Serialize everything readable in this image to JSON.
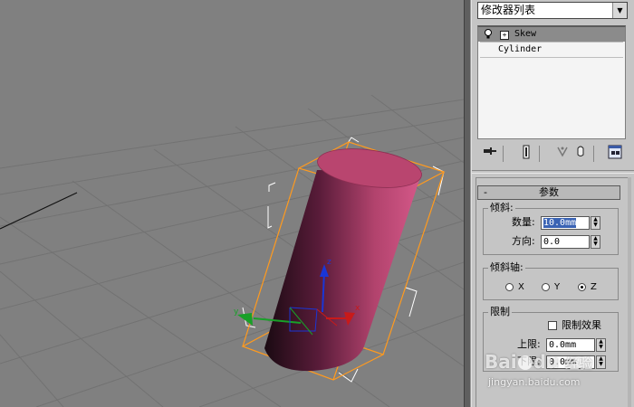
{
  "modifier_list": {
    "label": "修改器列表",
    "arrow": "▼"
  },
  "stack": {
    "items": [
      {
        "label": "Skew",
        "selected": true
      },
      {
        "label": "Cylinder",
        "selected": false
      }
    ]
  },
  "toolbar": {
    "icons": [
      "pin-stack-icon",
      "show-end-result-icon",
      "make-unique-icon",
      "remove-modifier-icon",
      "configure-modifier-sets-icon"
    ]
  },
  "params": {
    "rollout_title": "参数",
    "rollout_minus": "-",
    "skew_group": {
      "title": "倾斜:",
      "amount_label": "数量:",
      "amount_value": "10.0mm",
      "direction_label": "方向:",
      "direction_value": "0.0"
    },
    "axis_group": {
      "title": "倾斜轴:",
      "options": [
        "X",
        "Y",
        "Z"
      ],
      "selected": "Z"
    },
    "limit_group": {
      "title": "限制",
      "limit_effect_label": "限制效果",
      "upper_label": "上限:",
      "upper_value": "0.0mm",
      "lower_label": "下限:",
      "lower_value": "0.0mm"
    }
  },
  "watermark": {
    "line1": "Bai",
    "line2": "du",
    "line3": "经验",
    "url": "jingyan.baidu.com"
  },
  "colors": {
    "viewport_bg": "#808080",
    "cylinder": "#b7456f",
    "bounding": "#ff9a1e",
    "panel_bg": "#c5c5c5"
  }
}
